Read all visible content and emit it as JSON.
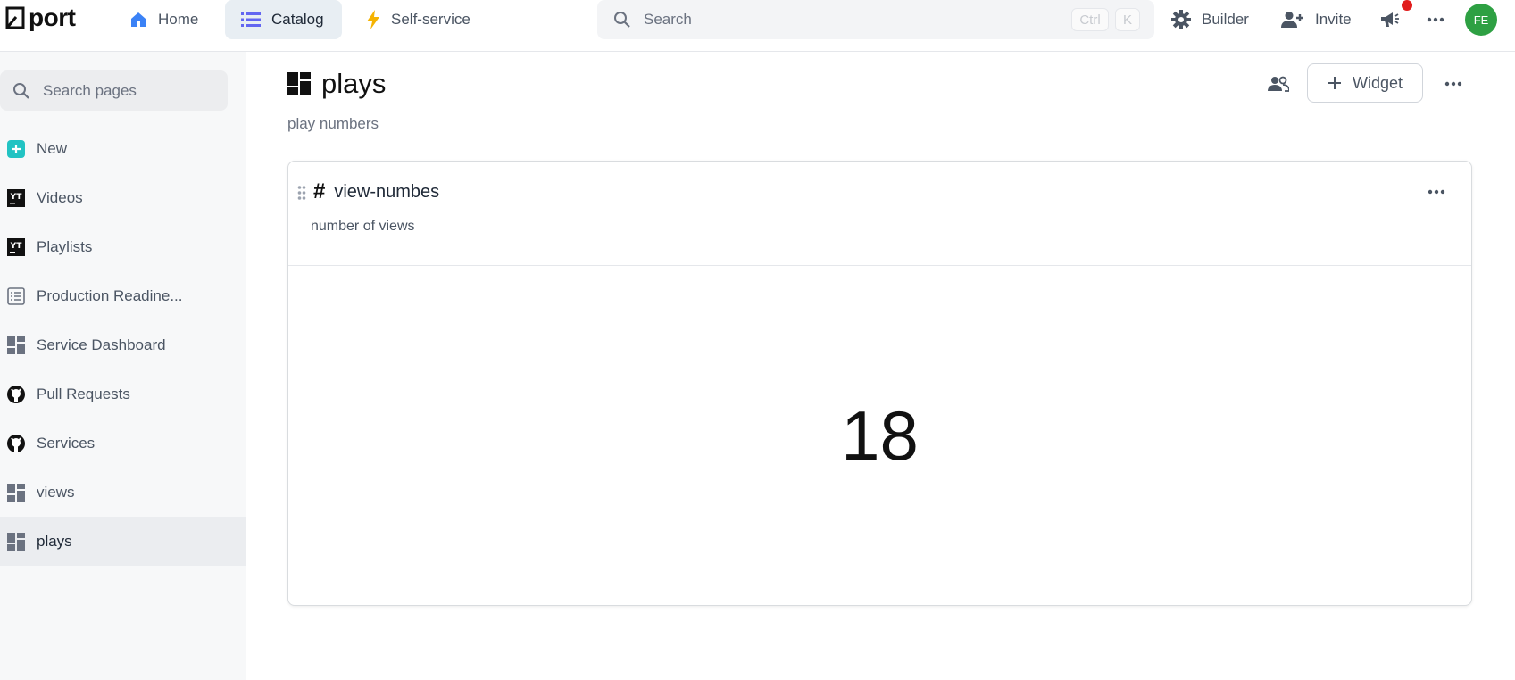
{
  "brand": {
    "name": "port"
  },
  "topnav": {
    "home": "Home",
    "catalog": "Catalog",
    "self_service": "Self-service"
  },
  "search": {
    "placeholder": "Search",
    "shortcut_ctrl": "Ctrl",
    "shortcut_key": "K"
  },
  "actions": {
    "builder": "Builder",
    "invite": "Invite"
  },
  "user": {
    "initials": "FE"
  },
  "sidebar": {
    "search_placeholder": "Search pages",
    "items": [
      {
        "label": "New",
        "icon": "plus-square-icon"
      },
      {
        "label": "Videos",
        "icon": "youtube-icon"
      },
      {
        "label": "Playlists",
        "icon": "youtube-icon"
      },
      {
        "label": "Production Readine...",
        "icon": "scorecard-icon"
      },
      {
        "label": "Service Dashboard",
        "icon": "dashboard-icon"
      },
      {
        "label": "Pull Requests",
        "icon": "github-icon"
      },
      {
        "label": "Services",
        "icon": "github-icon"
      },
      {
        "label": "views",
        "icon": "dashboard-icon"
      },
      {
        "label": "plays",
        "icon": "dashboard-icon",
        "active": true
      }
    ]
  },
  "page": {
    "title": "plays",
    "subtitle": "play numbers",
    "widget_button": "Widget"
  },
  "widget": {
    "title": "view-numbes",
    "description": "number of views",
    "value": "18"
  },
  "colors": {
    "accent_blue": "#3b82f6",
    "catalog_icon": "#6366f1",
    "self_service_icon": "#f5b301",
    "notification": "#e11d1d",
    "avatar": "#2ea043",
    "new_icon": "#22c3c3"
  }
}
